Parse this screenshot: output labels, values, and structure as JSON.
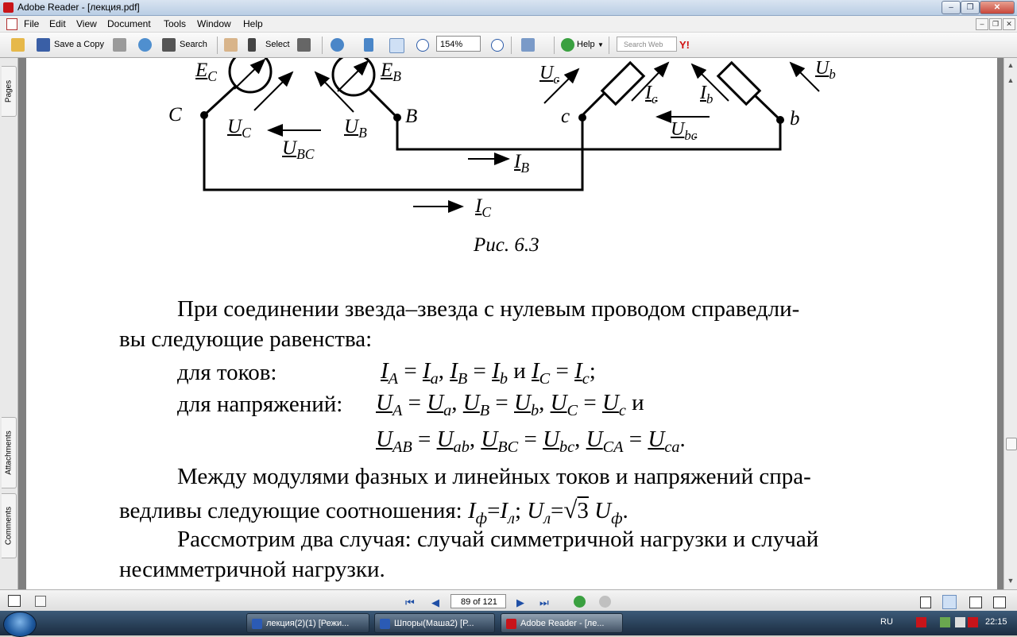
{
  "window": {
    "title": "Adobe Reader - [лекция.pdf]",
    "minimize": "‒",
    "restore": "❐",
    "close": "✕"
  },
  "menu": [
    "File",
    "Edit",
    "View",
    "Document",
    "Tools",
    "Window",
    "Help"
  ],
  "toolbar": {
    "save_copy": "Save a Copy",
    "search": "Search",
    "select": "Select",
    "zoom": "154%",
    "help": "Help",
    "search_web_placeholder": "Search Web"
  },
  "left_tabs": [
    "Pages",
    "Attachments",
    "Comments"
  ],
  "document": {
    "figure_labels": {
      "EC": "E",
      "EC_sub": "C",
      "EB": "E",
      "EB_sub": "B",
      "C": "C",
      "B": "B",
      "c": "c",
      "b": "b",
      "UC": "U",
      "UC_sub": "C",
      "UB": "U",
      "UB_sub": "B",
      "UBC": "U",
      "UBC_sub": "BC",
      "IB": "I",
      "IB_sub": "B",
      "IC": "I",
      "IC_sub": "C",
      "Uc": "U",
      "Uc_sub": "c",
      "Ic": "I",
      "Ic_sub": "c",
      "Ib": "I",
      "Ib_sub": "b",
      "Ub": "U",
      "Ub_sub": "b",
      "Ubc": "U",
      "Ubc_sub": "bc"
    },
    "caption": "Рис. 6.3",
    "para1_line1": "При соединении звезда–звезда с нулевым проводом справедли-",
    "para1_line2": "вы следующие равенства:",
    "currents_label": "для токов:",
    "voltages_label": "для напряжений:",
    "conj_and": "и",
    "para2_line1": "Между модулями фазных и линейных токов и напряжений спра-",
    "para2_line2_text": "ведливы следующие соотношения:",
    "para3_line1": "Рассмотрим два случая: случай симметричной нагрузки и случай",
    "para3_line2": "несимметричной нагрузки."
  },
  "status": {
    "page": "89 of 121"
  },
  "taskbar": {
    "tasks": [
      "лекция(2)(1) [Режи...",
      "Шпоры(Маша2) [Р...",
      "Adobe Reader - [ле..."
    ],
    "lang": "RU",
    "time": "22:15"
  }
}
